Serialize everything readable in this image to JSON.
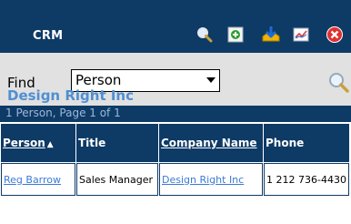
{
  "app": {
    "title": "CRM"
  },
  "toolbar": {
    "icons": [
      {
        "name": "search-icon"
      },
      {
        "name": "add-record-icon"
      },
      {
        "name": "download-icon"
      },
      {
        "name": "chart-icon"
      },
      {
        "name": "close-icon"
      }
    ]
  },
  "find": {
    "label": "Find",
    "selected": "Person",
    "options": [
      "Person"
    ]
  },
  "company": {
    "name": "Design Right Inc"
  },
  "results": {
    "summary": "1 Person, Page 1 of 1"
  },
  "table": {
    "columns": [
      {
        "label": "Person",
        "sortable": true,
        "sorted": "asc"
      },
      {
        "label": "Title",
        "sortable": false
      },
      {
        "label": "Company Name",
        "sortable": true
      },
      {
        "label": "Phone",
        "sortable": false
      }
    ],
    "rows": [
      {
        "person": "Reg Barrow",
        "title": "Sales Manager",
        "company": "Design Right Inc",
        "phone": "1 212 736-4430"
      }
    ]
  },
  "colors": {
    "header_bg": "#0e3a66",
    "find_bg": "#e1e1e1",
    "accent_link": "#3a7bd5",
    "company_heading": "#4f8fd1",
    "results_text": "#9db9db"
  }
}
